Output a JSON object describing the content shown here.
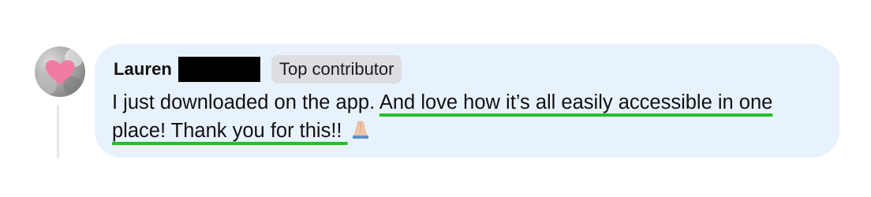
{
  "comment": {
    "author": "Lauren",
    "badge": "Top contributor",
    "text_plain": "I just downloaded on the app. ",
    "text_highlight": "And love how it’s all easily accessible in one place! Thank you for this!! ",
    "emoji_icon": "folded-hands-icon",
    "avatar_icon": "heart-icon"
  },
  "colors": {
    "bubble": "#e8f2fd",
    "highlight_underline": "#22c12a",
    "heart": "#f07ca5",
    "redaction": "#000000"
  }
}
